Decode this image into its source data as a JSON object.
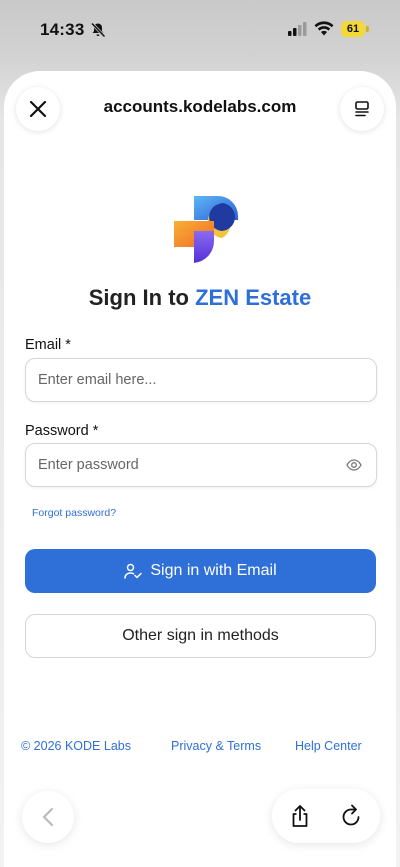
{
  "status_bar": {
    "time": "14:33",
    "battery": "61"
  },
  "browser": {
    "url": "accounts.kodelabs.com"
  },
  "login": {
    "title_prefix": "Sign In to ",
    "title_brand": "ZEN Estate",
    "email_label": "Email *",
    "email_placeholder": "Enter email here...",
    "password_label": "Password *",
    "password_placeholder": "Enter password",
    "forgot": "Forgot password?",
    "sign_in_email": "Sign in with Email",
    "other_methods": "Other sign in methods"
  },
  "footer": {
    "copyright": "© 2026 KODE Labs",
    "privacy": "Privacy & Terms",
    "help": "Help Center"
  },
  "colors": {
    "accent": "#2f6fd8"
  },
  "icons": [
    "bell-slash-icon",
    "cellular-signal-icon",
    "wifi-icon",
    "battery-icon",
    "close-icon",
    "menu-icon",
    "app-logo",
    "eye-icon",
    "user-check-icon",
    "chevron-left-icon",
    "share-icon",
    "reload-icon"
  ]
}
